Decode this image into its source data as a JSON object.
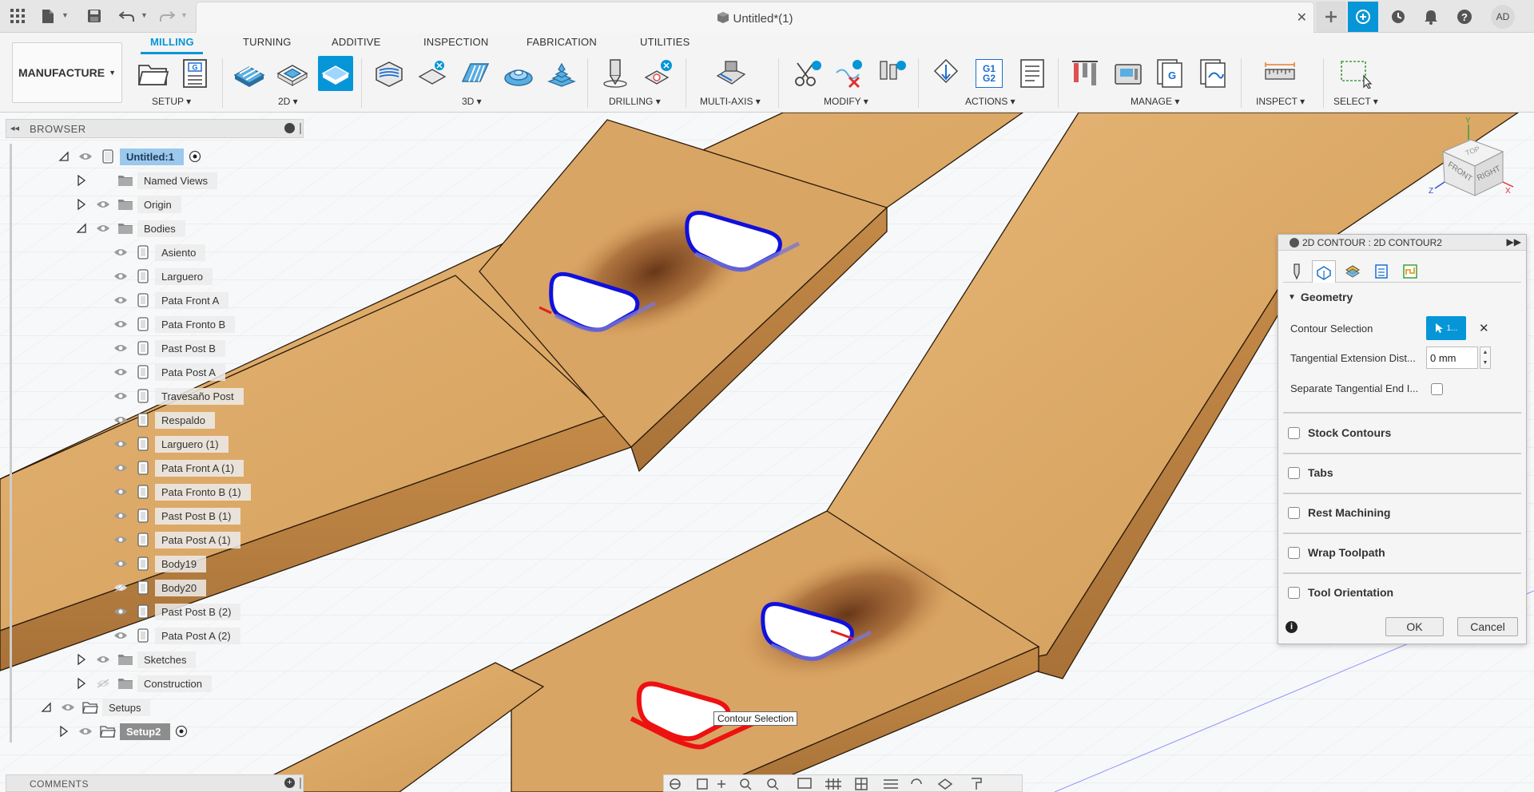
{
  "titlebar": {
    "document_title": "Untitled*(1)",
    "user_initials": "AD"
  },
  "ribbon": {
    "workspace": "MANUFACTURE",
    "tabs": [
      "MILLING",
      "TURNING",
      "ADDITIVE",
      "INSPECTION",
      "FABRICATION",
      "UTILITIES"
    ],
    "active_tab": "MILLING",
    "groups": [
      "SETUP",
      "2D",
      "3D",
      "DRILLING",
      "MULTI-AXIS",
      "MODIFY",
      "ACTIONS",
      "MANAGE",
      "INSPECT",
      "SELECT"
    ],
    "actions_g_code": "G1\nG2"
  },
  "browser": {
    "title": "BROWSER",
    "items": [
      {
        "label": "Untitled:1"
      },
      {
        "label": "Named Views"
      },
      {
        "label": "Origin"
      },
      {
        "label": "Bodies"
      },
      {
        "label": "Asiento"
      },
      {
        "label": "Larguero"
      },
      {
        "label": "Pata Front A"
      },
      {
        "label": "Pata Fronto B"
      },
      {
        "label": "Past Post B"
      },
      {
        "label": "Pata Post A"
      },
      {
        "label": "Travesaño Post"
      },
      {
        "label": "Respaldo"
      },
      {
        "label": "Larguero (1)"
      },
      {
        "label": "Pata Front A (1)"
      },
      {
        "label": "Pata Fronto B (1)"
      },
      {
        "label": "Past Post B (1)"
      },
      {
        "label": "Pata Post A (1)"
      },
      {
        "label": "Body19"
      },
      {
        "label": "Body20"
      },
      {
        "label": "Past Post B (2)"
      },
      {
        "label": "Pata Post A (2)"
      },
      {
        "label": "Sketches"
      },
      {
        "label": "Construction"
      },
      {
        "label": "Setups"
      },
      {
        "label": "Setup2"
      }
    ]
  },
  "dialog": {
    "title": "2D CONTOUR : 2D CONTOUR2",
    "geometry_heading": "Geometry",
    "contour_selection_label": "Contour Selection",
    "contour_selection_value": "1...",
    "tangential_ext_label": "Tangential Extension Dist...",
    "tangential_ext_value": "0 mm",
    "separate_tangential_label": "Separate Tangential End I...",
    "sections": [
      "Stock Contours",
      "Tabs",
      "Rest Machining",
      "Wrap Toolpath",
      "Tool Orientation"
    ],
    "ok": "OK",
    "cancel": "Cancel"
  },
  "viewcube": {
    "top": "TOP",
    "front": "FRONT",
    "right": "RIGHT",
    "axis_x": "X",
    "axis_y": "Y",
    "axis_z": "Z"
  },
  "tooltip": "Contour Selection",
  "comments": {
    "title": "COMMENTS"
  }
}
